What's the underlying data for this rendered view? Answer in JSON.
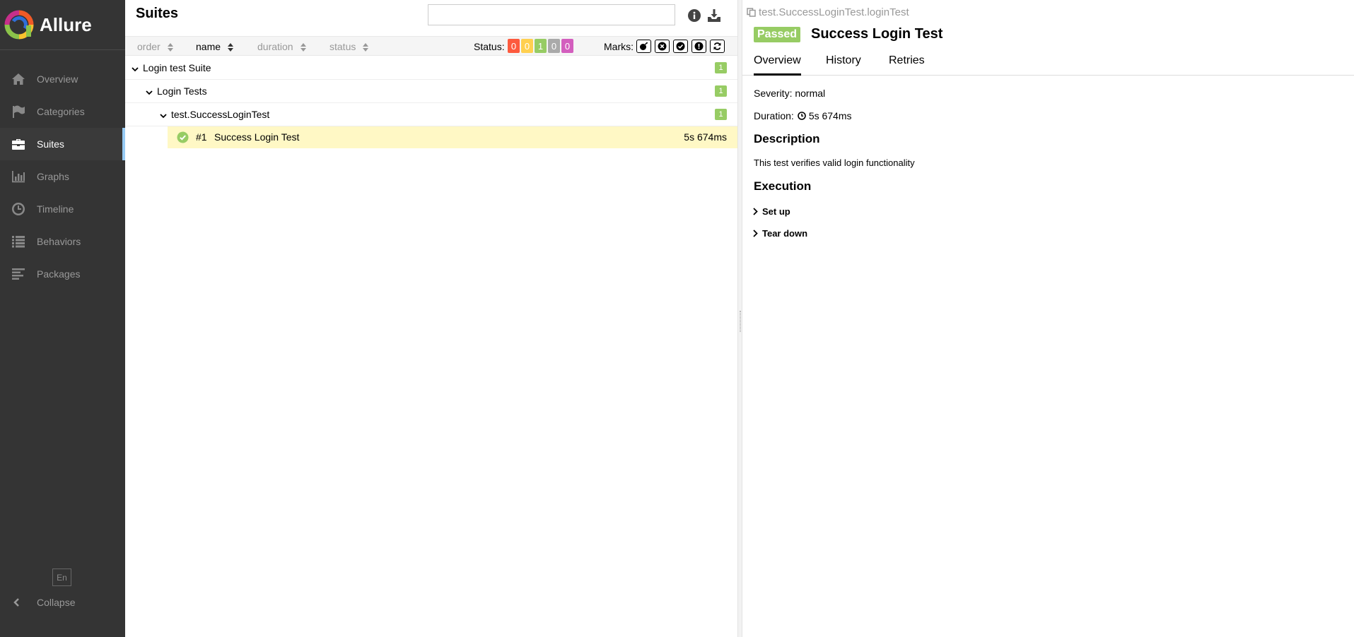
{
  "brand": {
    "name": "Allure"
  },
  "sidebar": {
    "items": [
      {
        "label": "Overview",
        "icon": "home-icon",
        "active": false
      },
      {
        "label": "Categories",
        "icon": "flag-icon",
        "active": false
      },
      {
        "label": "Suites",
        "icon": "briefcase-icon",
        "active": true
      },
      {
        "label": "Graphs",
        "icon": "bar-chart-icon",
        "active": false
      },
      {
        "label": "Timeline",
        "icon": "clock-icon",
        "active": false
      },
      {
        "label": "Behaviors",
        "icon": "list-icon",
        "active": false
      },
      {
        "label": "Packages",
        "icon": "align-left-icon",
        "active": false
      }
    ],
    "language": "En",
    "collapse": "Collapse"
  },
  "suites": {
    "title": "Suites",
    "search": {
      "value": "",
      "placeholder": ""
    },
    "sort": {
      "order": "order",
      "name": "name",
      "duration": "duration",
      "status": "status"
    },
    "status_label": "Status:",
    "counts": [
      {
        "value": "0",
        "color": "#fd5a3e"
      },
      {
        "value": "0",
        "color": "#ffd050"
      },
      {
        "value": "1",
        "color": "#97cc64"
      },
      {
        "value": "0",
        "color": "#aaaaaa"
      },
      {
        "value": "0",
        "color": "#d35ebe"
      }
    ],
    "marks_label": "Marks:",
    "tree": {
      "suite": {
        "label": "Login test Suite",
        "count": "1"
      },
      "group": {
        "label": "Login Tests",
        "count": "1"
      },
      "class": {
        "label": "test.SuccessLoginTest",
        "count": "1"
      },
      "test": {
        "number": "#1",
        "name": "Success Login Test",
        "duration": "5s 674ms"
      }
    }
  },
  "detail": {
    "fullname": "test.SuccessLoginTest.loginTest",
    "status": "Passed",
    "title": "Success Login Test",
    "tabs": [
      "Overview",
      "History",
      "Retries"
    ],
    "severity": "Severity: normal",
    "duration_label": "Duration:",
    "duration": "5s 674ms",
    "description_heading": "Description",
    "description": "This test verifies valid login functionality",
    "execution_heading": "Execution",
    "setup": "Set up",
    "teardown": "Tear down"
  },
  "colors": {
    "passed": "#97cc64",
    "sidebar_bg": "#343434",
    "selected_row": "#fff8c5"
  }
}
